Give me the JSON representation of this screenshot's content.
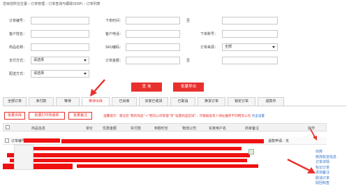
{
  "breadcrumb": "您目前所在位置 › 订单管理 › 订单查询与跟踪(SOP) › 订单列表",
  "form": {
    "order_no_label": "订单编号：",
    "order_time_label": "下单时间：",
    "to_label_1": "至",
    "customer_name_label": "客户姓名：",
    "customer_phone_label": "客户电话：",
    "order_account_label": "下单账号：",
    "product_name_label": "商品名称：",
    "sku_label": "SKU编码：",
    "order_source_label": "订单来源：",
    "order_source_value": "全部",
    "payment_label": "支付方式：",
    "payment_value": "请选择",
    "amount_label": "订单金额：",
    "to_label_2": "至",
    "delivery_label": "配送方式：",
    "delivery_value": "请选择"
  },
  "actions": {
    "search_label": "查 询",
    "export_label": "批量导出"
  },
  "tabs": [
    "全部订单",
    "未付款",
    "等待",
    "等待出库",
    "已出库",
    "买家已收货",
    "已取消",
    "换货订单",
    "锁定订单",
    "退款中"
  ],
  "toolbar": {
    "batch_ship": "批量出库",
    "batch_print": "批量打印快递单",
    "batch_remark": "批量备注"
  },
  "warning": {
    "text": "温馨提示：建议在“我的商品”→“物流公司管理”页“设置商品区域”，可根据收货人地址推荐不同物流公司",
    "link": "点击设置"
  },
  "table": {
    "headers": [
      "商品信息",
      "单价",
      "优惠金额",
      "实付款",
      "到款时长",
      "物流公司",
      "买家用户名",
      "商家备注",
      "操作"
    ]
  },
  "order": {
    "order_no_label": "订单编号：",
    "refund_status": "退款申请：无"
  },
  "ops": [
    "出库",
    "修改收货信息",
    "订单详情",
    "标记订单",
    "添加备注",
    "取消订单",
    "驳回标签"
  ]
}
